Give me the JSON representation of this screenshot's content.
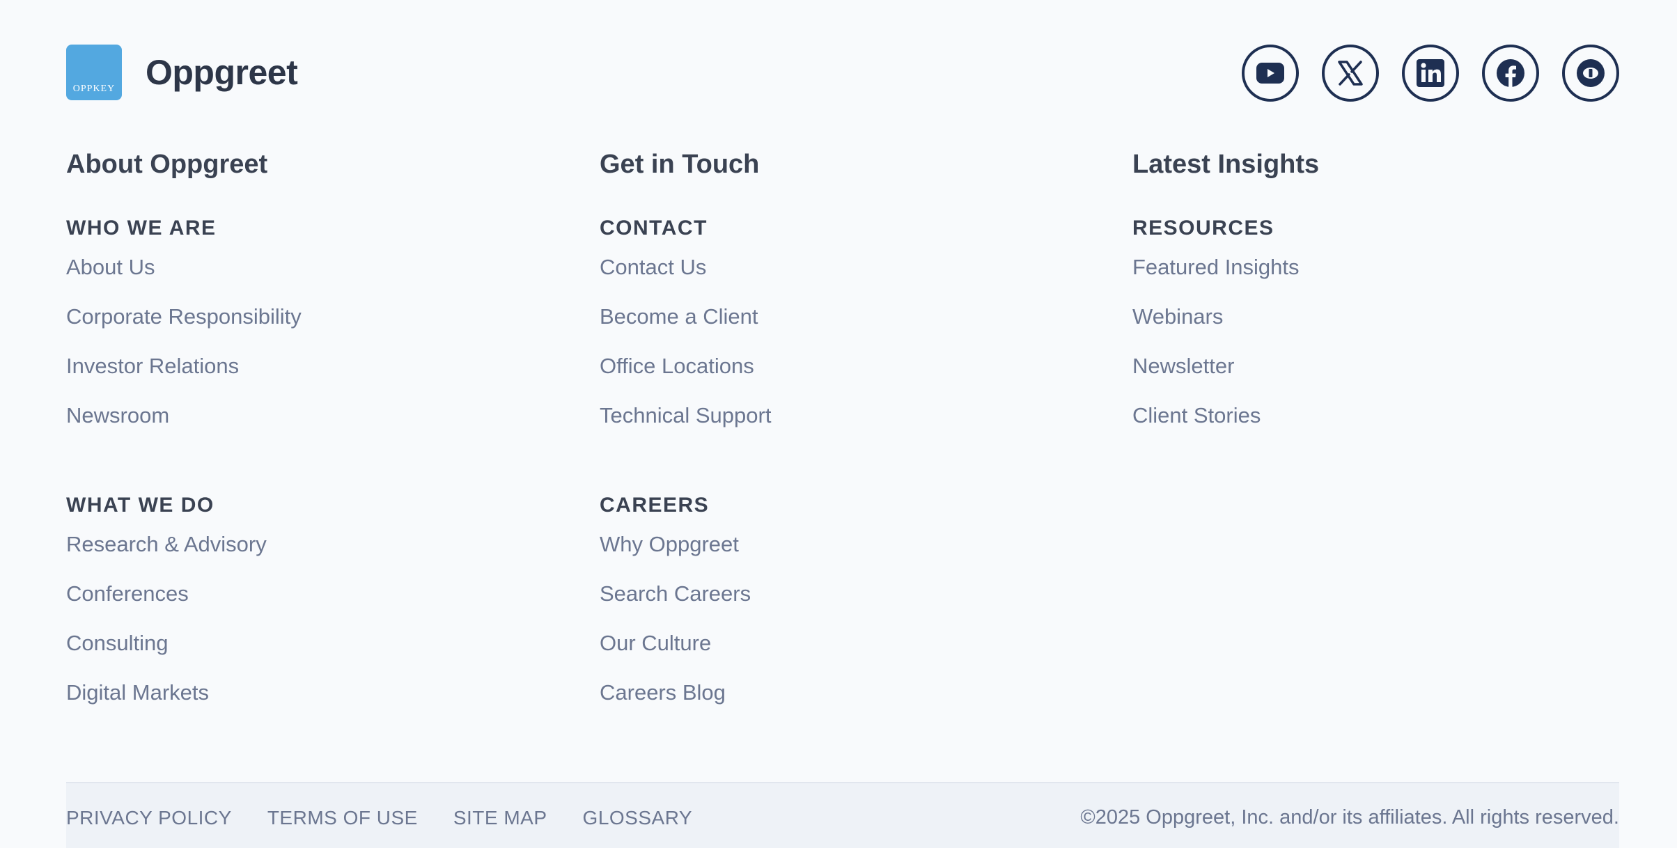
{
  "brand": {
    "logo_text": "OPPKEY",
    "name": "Oppgreet",
    "accent_color": "#53a8e0"
  },
  "socials": [
    {
      "icon": "youtube-icon",
      "label": "YouTube"
    },
    {
      "icon": "x-icon",
      "label": "X"
    },
    {
      "icon": "linkedin-icon",
      "label": "LinkedIn"
    },
    {
      "icon": "facebook-icon",
      "label": "Facebook"
    },
    {
      "icon": "glassdoor-icon",
      "label": "Glassdoor"
    }
  ],
  "columns": [
    {
      "title": "About Oppgreet",
      "groups": [
        {
          "heading": "WHO WE ARE",
          "links": [
            "About Us",
            "Corporate Responsibility",
            "Investor Relations",
            "Newsroom"
          ]
        },
        {
          "heading": "WHAT WE DO",
          "links": [
            "Research & Advisory",
            "Conferences",
            "Consulting",
            "Digital Markets"
          ]
        }
      ]
    },
    {
      "title": "Get in Touch",
      "groups": [
        {
          "heading": "CONTACT",
          "links": [
            "Contact Us",
            "Become a Client",
            "Office Locations",
            "Technical Support"
          ]
        },
        {
          "heading": "CAREERS",
          "links": [
            "Why Oppgreet",
            "Search Careers",
            "Our Culture",
            "Careers Blog"
          ]
        }
      ]
    },
    {
      "title": "Latest Insights",
      "groups": [
        {
          "heading": "RESOURCES",
          "links": [
            "Featured Insights",
            "Webinars",
            "Newsletter",
            "Client Stories"
          ]
        }
      ]
    }
  ],
  "bottom": {
    "links": [
      "PRIVACY POLICY",
      "TERMS OF USE",
      "SITE MAP",
      "GLOSSARY"
    ],
    "copyright": "©2025 Oppgreet, Inc. and/or its affiliates. All rights reserved."
  }
}
